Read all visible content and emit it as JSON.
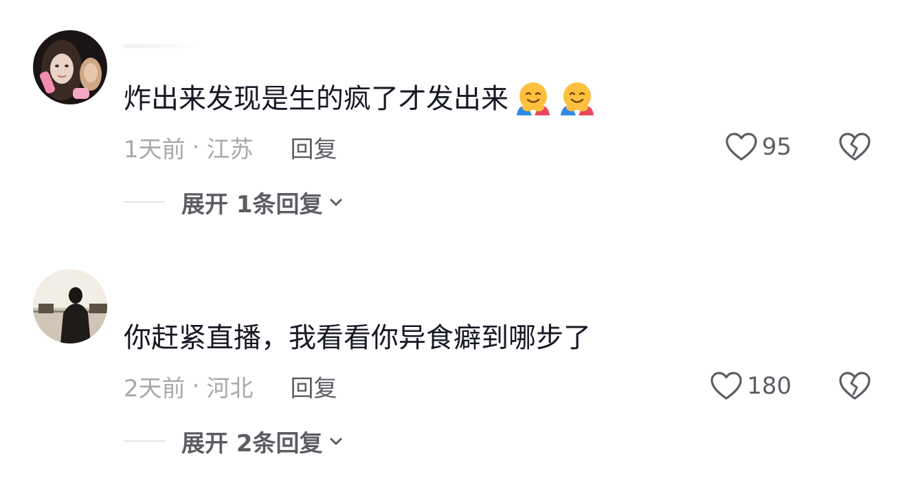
{
  "comments": [
    {
      "username": "",
      "text": "炸出来发现是生的疯了才发出来",
      "emojis": [
        "hugging-face-emoji",
        "hugging-face-emoji"
      ],
      "time": "1天前",
      "separator": "·",
      "location": "江苏",
      "reply_label": "回复",
      "likes": "95",
      "expand_label": "展开 1条回复"
    },
    {
      "username": "",
      "text": "你赶紧直播，我看看你异食癖到哪步了",
      "emojis": [],
      "time": "2天前",
      "separator": "·",
      "location": "河北",
      "reply_label": "回复",
      "likes": "180",
      "expand_label": "展开 2条回复"
    }
  ],
  "icons": {
    "like": "heart-outline-icon",
    "dislike": "broken-heart-icon",
    "expand": "chevron-down-icon"
  },
  "colors": {
    "text_primary": "#161823",
    "text_meta": "#a8a9ad",
    "text_secondary": "#5c5d63",
    "divider": "#e3e3e6"
  }
}
